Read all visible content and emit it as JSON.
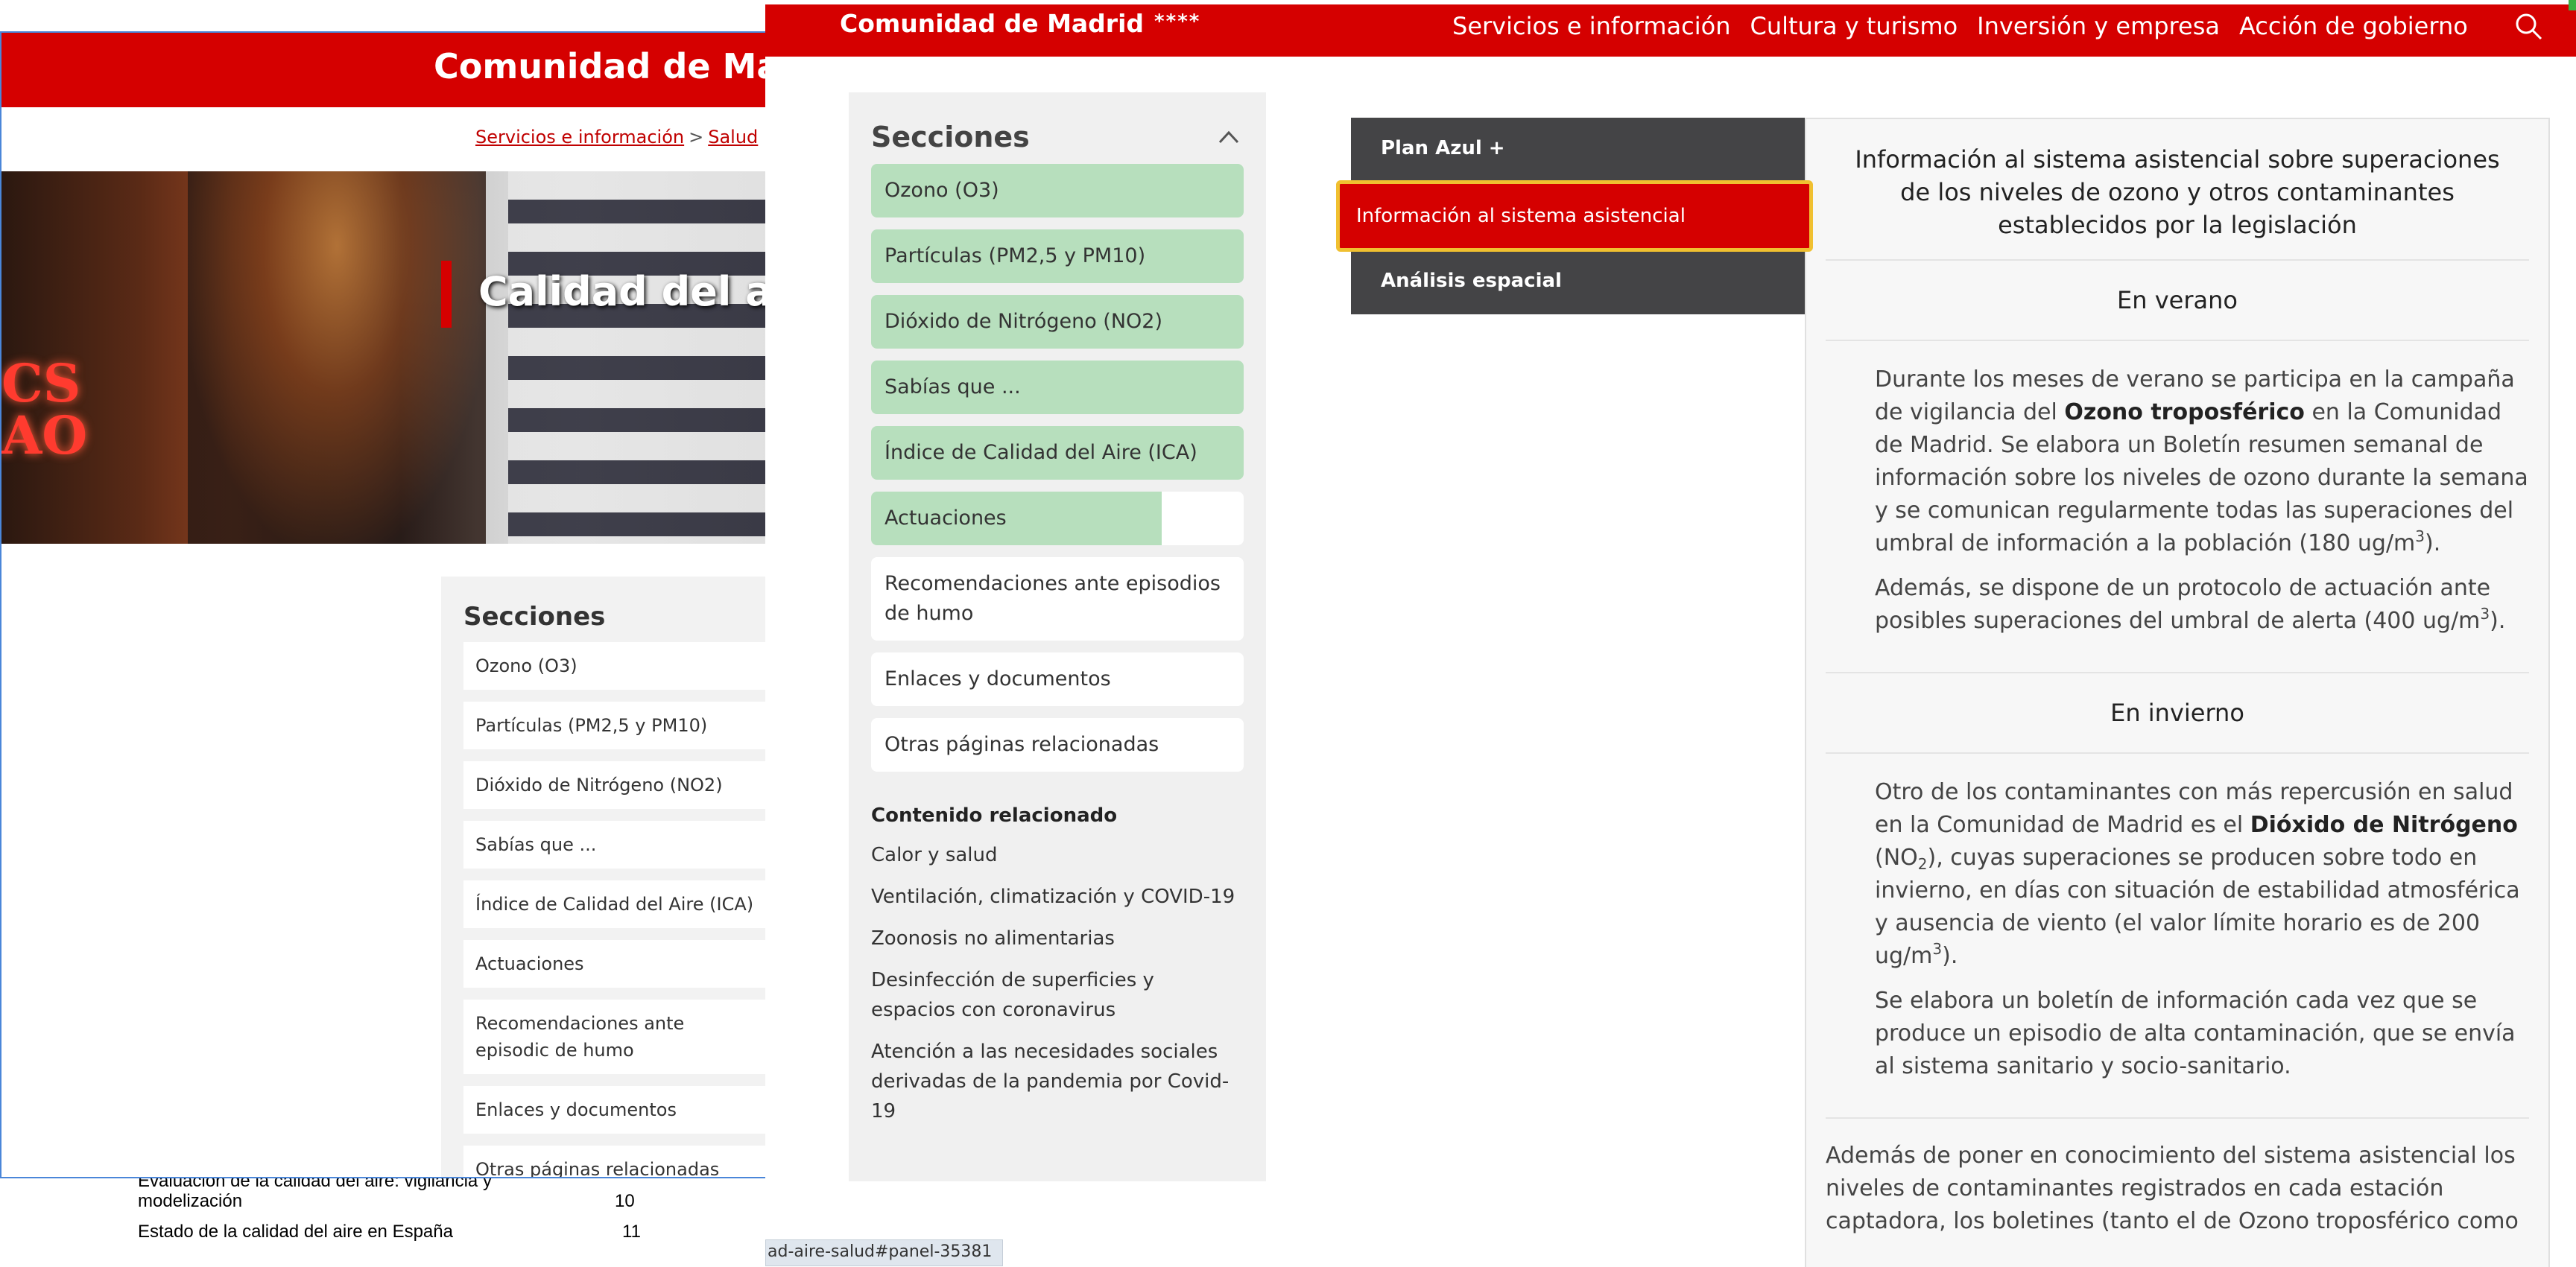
{
  "background_doc": {
    "rows": [
      {
        "title": "Evaluación de la calidad del aire: vigilancia y modelización",
        "page": "10"
      },
      {
        "title": "Estado de la calidad del aire en España",
        "page": "11"
      }
    ]
  },
  "back_window": {
    "logo": "Comunidad de Madr",
    "breadcrumb": {
      "link1": "Servicios e información",
      "sep": ">",
      "link2": "Salud"
    },
    "hero": {
      "sign_text": "CS\nAO",
      "title": "Calidad del air"
    },
    "sections": {
      "heading": "Secciones",
      "items": [
        "Ozono (O3)",
        "Partículas (PM2,5 y PM10)",
        "Dióxido de Nitrógeno (NO2)",
        "Sabías que ...",
        "Índice de Calidad del Aire (ICA)",
        "Actuaciones",
        "Recomendaciones ante episodic de humo",
        "Enlaces y documentos",
        "Otras páginas relacionadas"
      ]
    }
  },
  "nav": {
    "logo": "Comunidad de Madrid",
    "stars": "****",
    "menu": [
      "Servicios e información",
      "Cultura y turismo",
      "Inversión y empresa",
      "Acción de gobierno"
    ],
    "search_icon": "search-icon"
  },
  "sidebar": {
    "heading": "Secciones",
    "items": [
      "Ozono (O3)",
      "Partículas (PM2,5 y PM10)",
      "Dióxido de Nitrógeno (NO2)",
      "Sabías que ...",
      "Índice de Calidad del Aire (ICA)",
      "Actuaciones",
      "Recomendaciones ante episodios de humo",
      "Enlaces y documentos",
      "Otras páginas relacionadas"
    ],
    "related_heading": "Contenido relacionado",
    "related_links": [
      "Calor y salud",
      "Ventilación, climatización y COVID-19",
      "Zoonosis no alimentarias",
      "Desinfección de superficies y espacios con coronavirus",
      "Atención a las necesidades sociales derivadas de la pandemia por Covid-19"
    ]
  },
  "tabs": [
    "Plan Azul +",
    "Información al sistema asistencial",
    "Análisis espacial"
  ],
  "panel": {
    "title": "Información al sistema asistencial sobre superaciones de los niveles de ozono y otros contaminantes establecidos por la legislación",
    "summer_heading": "En verano",
    "summer_p1_a": "Durante los meses de verano se participa en la campaña de vigilancia del ",
    "summer_p1_b": "Ozono troposférico",
    "summer_p1_c": " en la Comunidad de Madrid. Se elabora un Boletín resumen semanal de información sobre los niveles de ozono durante la semana y se comunican regularmente todas las superaciones del umbral de información a la población (180 ug/m",
    "summer_p1_d": ").",
    "summer_p2_a": "Además, se dispone de un protocolo de actuación ante posibles superaciones del umbral de alerta (400 ug/m",
    "summer_p2_b": ").",
    "winter_heading": "En invierno",
    "winter_p1_a": "Otro de los contaminantes con más repercusión en salud en la Comunidad de Madrid es el ",
    "winter_p1_b": "Dióxido de Nitrógeno",
    "winter_p1_c": " (NO",
    "winter_p1_d": "), cuyas superaciones se producen sobre todo en invierno, en días con situación de estabilidad atmosférica y ausencia de viento (el valor límite horario es de 200 ug/m",
    "winter_p1_e": ").",
    "winter_p2": "Se elabora un boletín de información cada vez que se produce un episodio de alta contaminación, que se envía al sistema sanitario y socio-sanitario.",
    "last_p": "Además de poner en conocimiento del sistema asistencial los niveles de contaminantes registrados en cada estación captadora, los boletines (tanto el de Ozono troposférico como",
    "sup3": "3",
    "sub2": "2"
  },
  "statusbar": "ad-aire-salud#panel-35381",
  "colors": {
    "brand_red": "#d50000",
    "section_green": "#b7dfbd",
    "tab_dark": "#444446",
    "focus_outline": "#f0c030"
  }
}
